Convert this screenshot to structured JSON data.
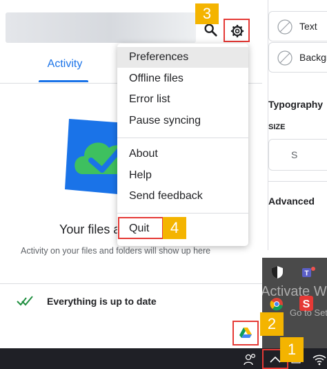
{
  "panel": {
    "tab_activity": "Activity",
    "empty_title": "Your files a",
    "empty_subtitle": "Activity on your files and folders will show up here",
    "status_text": "Everything is up to date"
  },
  "menu": {
    "items": [
      "Preferences",
      "Offline files",
      "Error list",
      "Pause syncing",
      "About",
      "Help",
      "Send feedback",
      "Quit"
    ]
  },
  "badges": {
    "step1": "1",
    "step2": "2",
    "step3": "3",
    "step4": "4"
  },
  "sidebar": {
    "text_label": "Text",
    "background_label": "Backgr",
    "typography_title": "Typography",
    "size_label": "SIZE",
    "size_value": "S",
    "advanced_title": "Advanced"
  },
  "tray": {
    "watermark_title": "Activate W",
    "watermark_sub": "Go to Setting"
  },
  "colors": {
    "accent": "#1a73e8",
    "highlight": "#e53935",
    "badge": "#f4b400",
    "status_check": "#1e8e3e"
  },
  "icons": [
    "search-icon",
    "gear-icon",
    "cloud-check-icon",
    "check-icon",
    "none-icon",
    "shield-icon",
    "teams-icon",
    "chrome-icon",
    "s-app-icon",
    "google-drive-icon",
    "people-icon",
    "chevron-up-icon",
    "wifi-icon"
  ]
}
